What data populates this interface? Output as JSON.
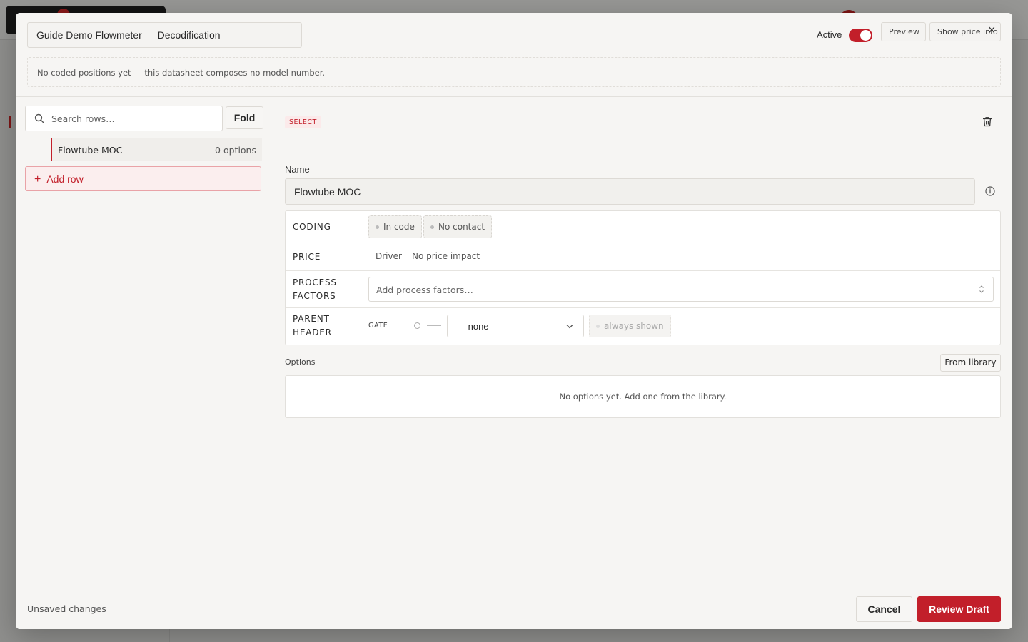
{
  "modal": {
    "title": "Guide Demo Flowmeter — Decodification",
    "active_label": "Active",
    "active": true,
    "preview_label": "Preview",
    "show_price_label": "Show price info",
    "notice": "No coded positions yet — this datasheet composes no model number."
  },
  "left": {
    "search_placeholder": "Search rows…",
    "fold_label": "Fold",
    "rows": [
      {
        "name": "Flowtube MOC",
        "count": "0 options"
      }
    ],
    "add_row_label": "Add row"
  },
  "detail": {
    "type_badge": "SELECT",
    "name_label": "Name",
    "name_value": "Flowtube MOC",
    "coding_label": "CODING",
    "coding_chips": [
      "In code",
      "No contact"
    ],
    "price_label": "PRICE",
    "price_driver": "Driver",
    "price_value": "No price impact",
    "process_label_1": "PROCESS",
    "process_label_2": "FACTORS",
    "process_placeholder": "Add process factors…",
    "parent_label_1": "PARENT",
    "parent_label_2": "HEADER",
    "gate_label": "GATE",
    "gate_select_value": "— none —",
    "always_shown": "always shown",
    "options_label": "Options",
    "from_library_label": "From library",
    "options_empty": "No options yet. Add one from the library."
  },
  "footer": {
    "status": "Unsaved changes",
    "cancel_label": "Cancel",
    "review_label": "Review Draft"
  },
  "colors": {
    "accent": "#c21f2a",
    "surface": "#f6f5f3",
    "border": "#e2e0dc"
  },
  "icons": [
    "search-icon",
    "trash-icon",
    "info-icon",
    "chevron-down-icon",
    "updown-chevron-icon",
    "close-icon",
    "plus-icon"
  ]
}
